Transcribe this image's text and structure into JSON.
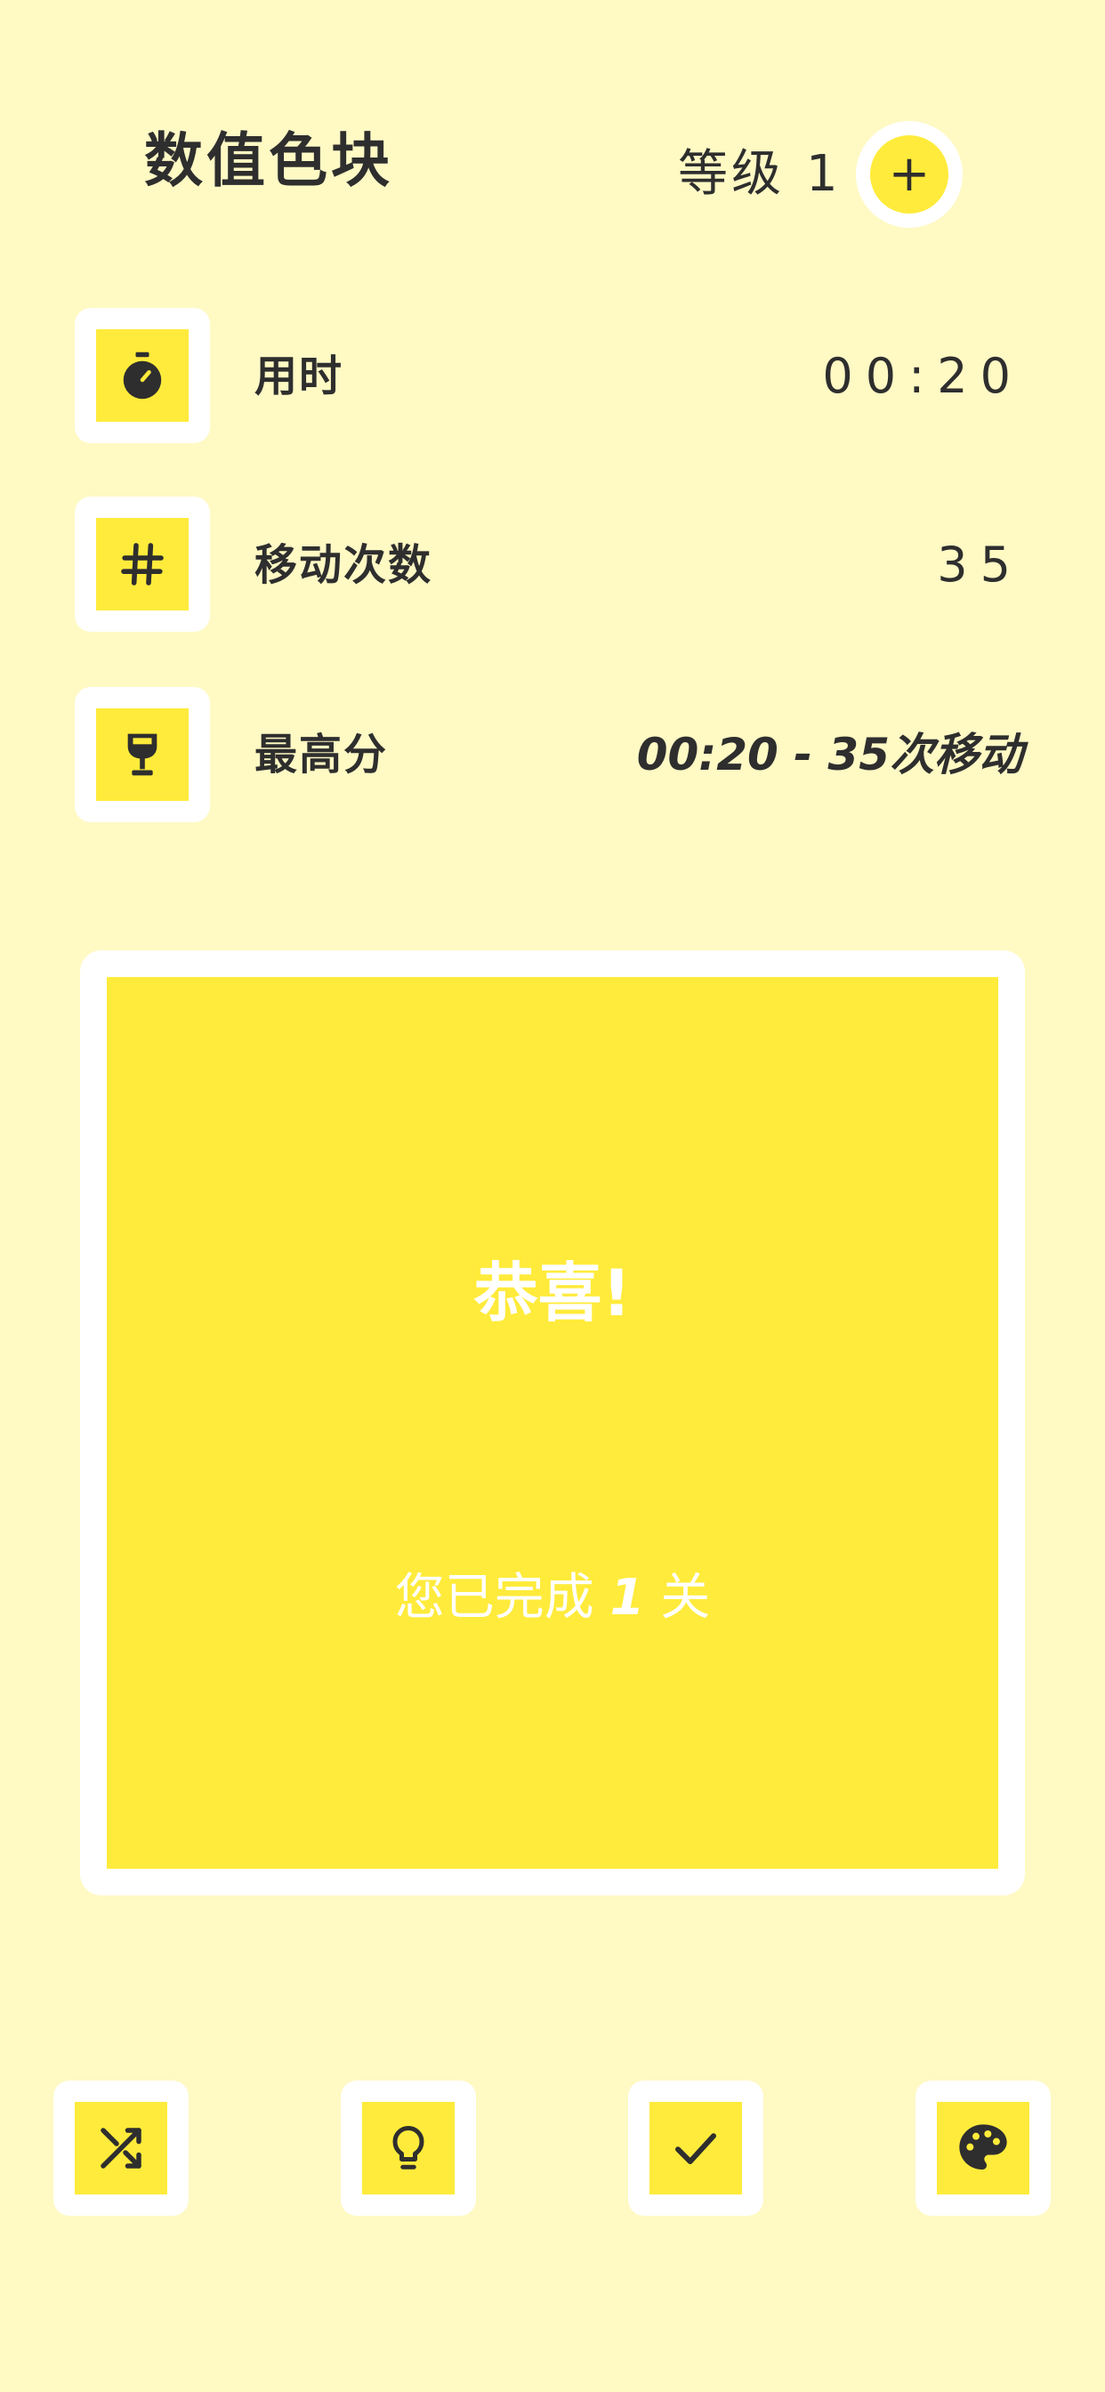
{
  "header": {
    "title": "数值色块",
    "level_label": "等级",
    "level_value": "1",
    "add_level_symbol": "+"
  },
  "stats": {
    "time": {
      "icon": "stopwatch-icon",
      "label": "用时",
      "value": "00:20"
    },
    "moves": {
      "icon": "hash-icon",
      "label": "移动次数",
      "value": "35"
    },
    "best": {
      "icon": "trophy-icon",
      "label": "最高分",
      "value": "00:20 - 35次移动"
    }
  },
  "board": {
    "congrats": "恭喜!",
    "completed_prefix": "您已完成",
    "completed_number": "1",
    "completed_suffix": "关"
  },
  "toolbar": {
    "shuffle_icon": "shuffle-icon",
    "hint_icon": "lightbulb-icon",
    "check_icon": "check-icon",
    "palette_icon": "palette-icon"
  },
  "colors": {
    "background": "#FFF9C4",
    "accent": "#FFEB3B",
    "card": "#FFFFFF",
    "text": "#2E2E2E"
  }
}
